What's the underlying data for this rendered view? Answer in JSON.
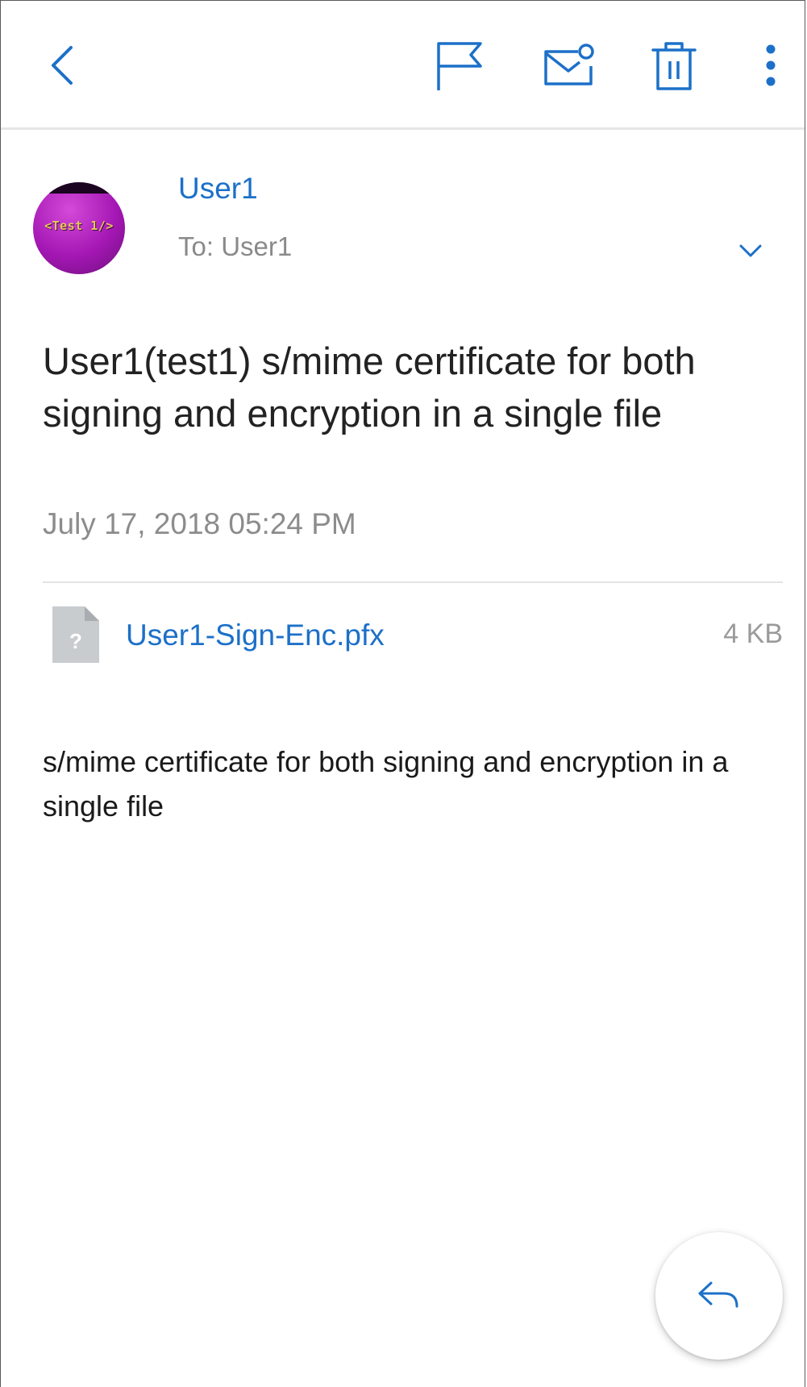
{
  "toolbar": {
    "icons": [
      "back-icon",
      "flag-icon",
      "mark-unread-icon",
      "trash-icon",
      "more-vertical-icon"
    ]
  },
  "colors": {
    "accent": "#1c70c8",
    "secondary_text": "#8a8a8a",
    "divider": "#e4e4e4",
    "avatar": "#a417b4"
  },
  "sender": {
    "avatar_text": "<Test 1/>",
    "name": "User1",
    "recipient_line": "To: User1"
  },
  "message": {
    "subject": "User1(test1) s/mime certificate for both signing and encryption in a single file",
    "date": "July 17, 2018 05:24 PM",
    "body": "s/mime certificate for both signing and encryption in a single file"
  },
  "attachment": {
    "icon_glyph": "?",
    "file_name": "User1-Sign-Enc.pfx",
    "file_size": "4 KB"
  },
  "reply": {
    "icon": "reply-icon"
  }
}
